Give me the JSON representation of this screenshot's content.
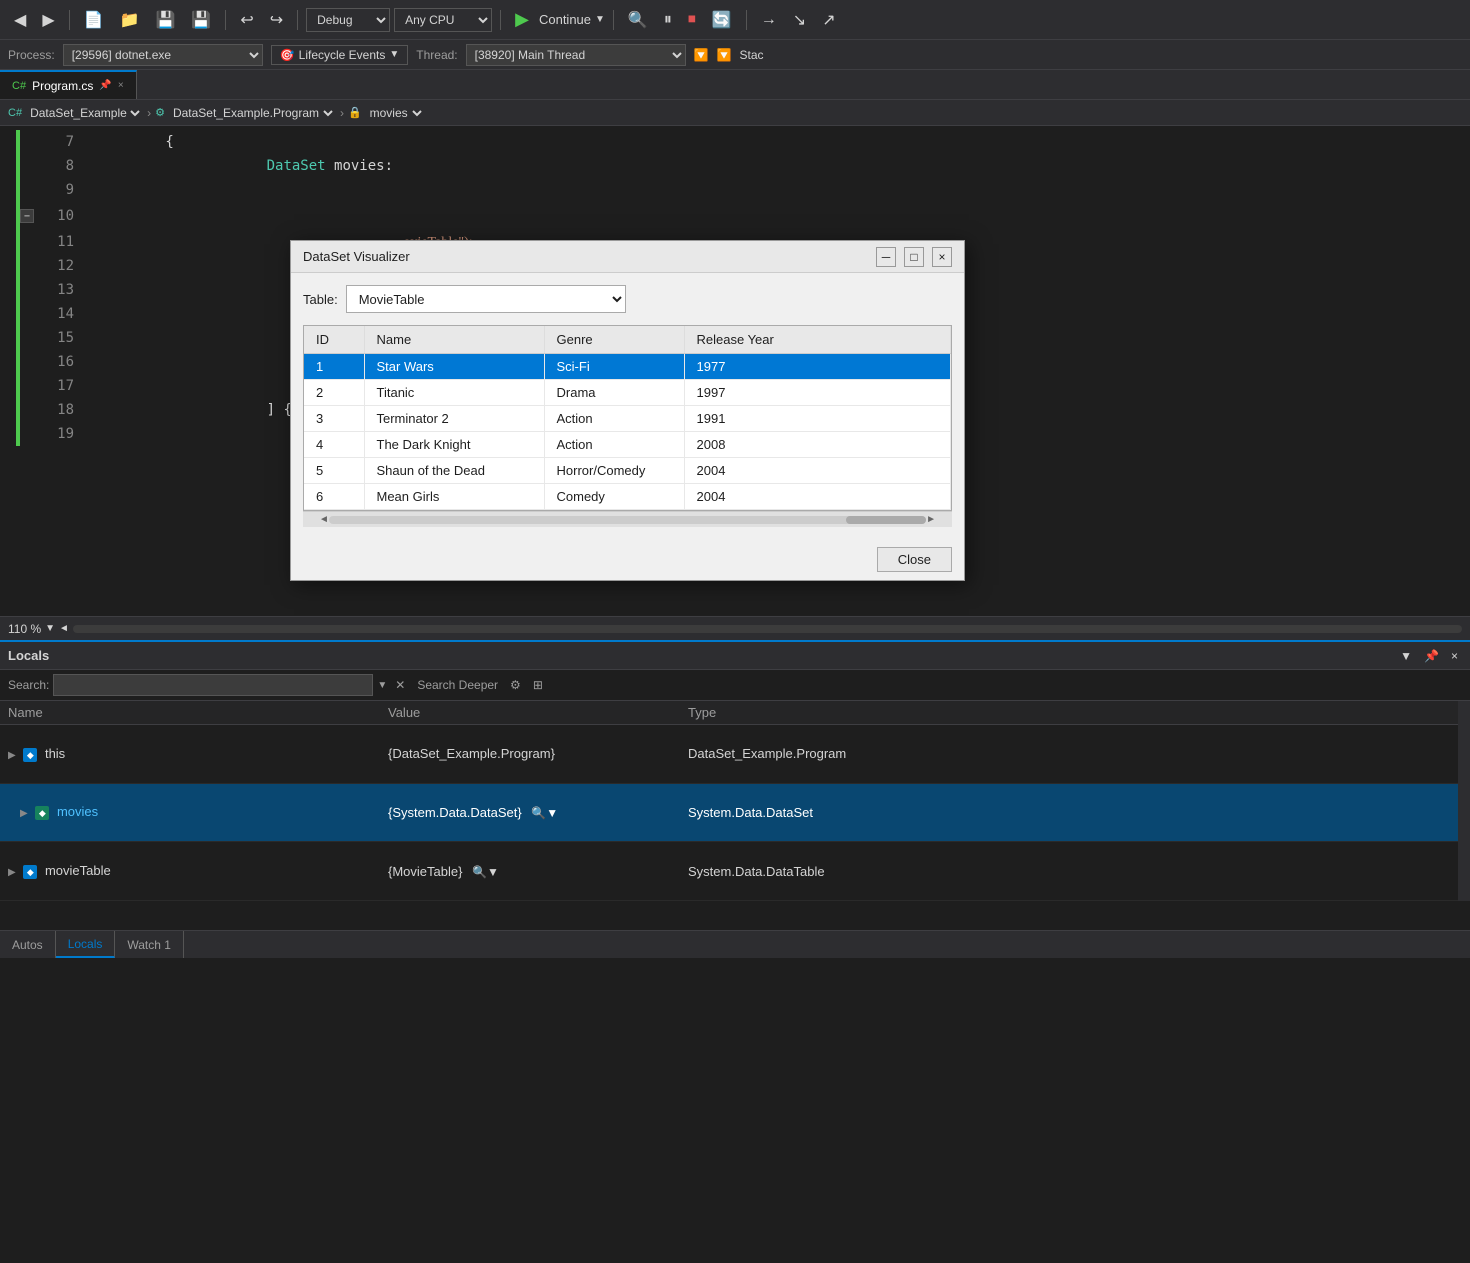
{
  "toolbar": {
    "debug_label": "Debug",
    "any_cpu_label": "Any CPU",
    "continue_label": "Continue"
  },
  "process_bar": {
    "process_label": "Process:",
    "process_value": "[29596] dotnet.exe",
    "lifecycle_label": "Lifecycle Events",
    "thread_label": "Thread:",
    "thread_value": "[38920] Main Thread",
    "stac_label": "Stac"
  },
  "tab": {
    "filename": "Program.cs",
    "pin_icon": "📌",
    "close_icon": "×"
  },
  "breadcrumb": {
    "namespace": "DataSet_Example",
    "class": "DataSet_Example.Program",
    "member": "movies"
  },
  "code_lines": [
    {
      "num": "7",
      "content": "        {"
    },
    {
      "num": "8",
      "content": "            DataSet movies:"
    },
    {
      "num": "9",
      "content": ""
    },
    {
      "num": "10",
      "content": ""
    },
    {
      "num": "11",
      "content": ""
    },
    {
      "num": "12",
      "content": ""
    },
    {
      "num": "13",
      "content": ""
    },
    {
      "num": "14",
      "content": ""
    },
    {
      "num": "15",
      "content": ""
    },
    {
      "num": "16",
      "content": ""
    },
    {
      "num": "17",
      "content": ""
    },
    {
      "num": "18",
      "content": "            ] { movieTabl"
    },
    {
      "num": "19",
      "content": ""
    }
  ],
  "zoom_bar": {
    "zoom_level": "110 %"
  },
  "modal": {
    "title": "DataSet Visualizer",
    "table_label": "Table:",
    "table_selected": "MovieTable",
    "table_options": [
      "MovieTable"
    ],
    "columns": [
      "ID",
      "Name",
      "Genre",
      "Release Year"
    ],
    "rows": [
      {
        "id": "1",
        "name": "Star Wars",
        "genre": "Sci-Fi",
        "year": "1977",
        "selected": true
      },
      {
        "id": "2",
        "name": "Titanic",
        "genre": "Drama",
        "year": "1997",
        "selected": false
      },
      {
        "id": "3",
        "name": "Terminator 2",
        "genre": "Action",
        "year": "1991",
        "selected": false
      },
      {
        "id": "4",
        "name": "The Dark Knight",
        "genre": "Action",
        "year": "2008",
        "selected": false
      },
      {
        "id": "5",
        "name": "Shaun of the Dead",
        "genre": "Horror/Comedy",
        "year": "2004",
        "selected": false
      },
      {
        "id": "6",
        "name": "Mean Girls",
        "genre": "Comedy",
        "year": "2004",
        "selected": false
      }
    ],
    "close_btn": "Close"
  },
  "locals_panel": {
    "title": "Locals",
    "search_label": "Search:",
    "search_placeholder": "",
    "search_deeper_label": "Search Deeper",
    "columns": {
      "name": "Name",
      "value": "Value",
      "type": "Type"
    },
    "rows": [
      {
        "name": "this",
        "expand": true,
        "icon": "cube",
        "value": "{DataSet_Example.Program}",
        "type": "DataSet_Example.Program",
        "indent": 0,
        "selected": false
      },
      {
        "name": "movies",
        "expand": true,
        "icon": "cube-teal",
        "value": "{System.Data.DataSet}",
        "type": "System.Data.DataSet",
        "indent": 1,
        "selected": true
      },
      {
        "name": "movieTable",
        "expand": true,
        "icon": "cube",
        "value": "{MovieTable}",
        "type": "System.Data.DataTable",
        "indent": 0,
        "selected": false
      }
    ]
  },
  "bottom_tabs": [
    {
      "label": "Autos",
      "active": false
    },
    {
      "label": "Locals",
      "active": true
    },
    {
      "label": "Watch 1",
      "active": false
    }
  ],
  "colors": {
    "accent": "#007acc",
    "selected_row": "#094771",
    "modal_selected": "#0078d4"
  }
}
